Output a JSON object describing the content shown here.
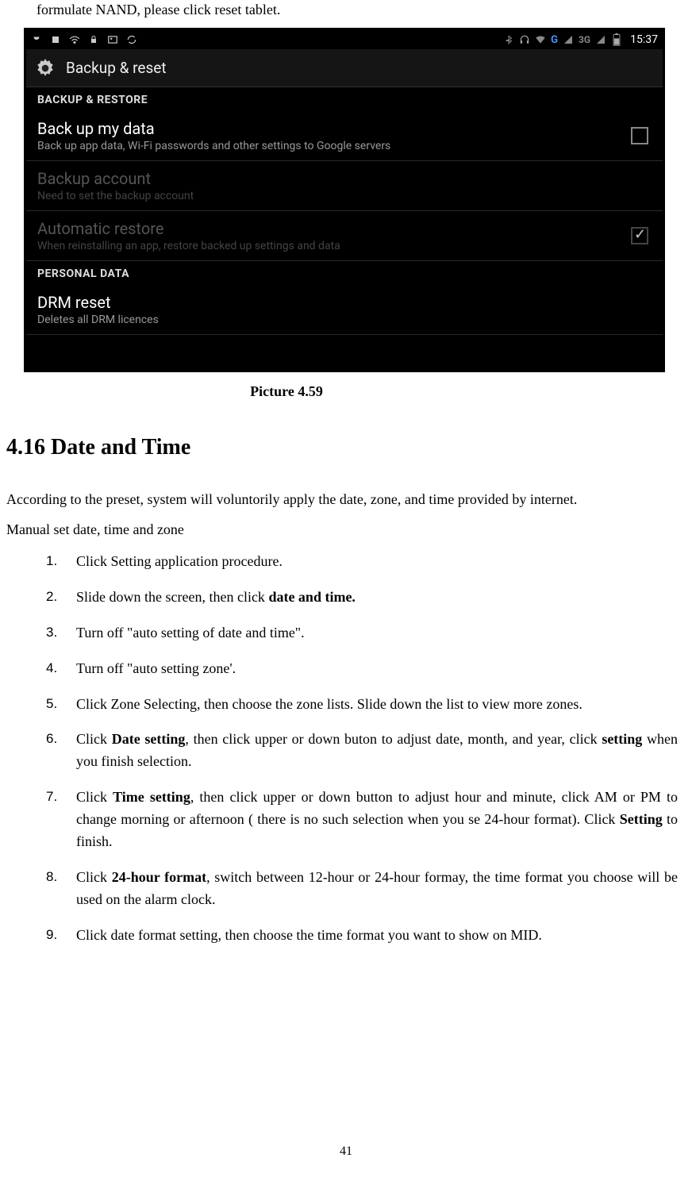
{
  "doc": {
    "top_line": "formulate NAND, please click reset tablet.",
    "caption": "Picture 4.59",
    "heading": "4.16 Date and Time",
    "para1": "According to the preset, system will voluntorily apply the date, zone, and time provided by internet.",
    "para2": "Manual set date, time and zone",
    "steps": {
      "s1": "Click Setting application procedure.",
      "s2a": "Slide down the screen, then click ",
      "s2b": "date and time.",
      "s3": "Turn off \"auto setting of date and time\".",
      "s4": "Turn off \"auto setting zone'.",
      "s5": "Click Zone Selecting, then choose the zone lists. Slide down the list to view more zones.",
      "s6a": "Click ",
      "s6b": "Date setting",
      "s6c": ", then click upper or down buton to adjust date, month, and year, click ",
      "s6d": "setting",
      "s6e": " when you finish selection.",
      "s7a": "Click ",
      "s7b": "Time setting",
      "s7c": ", then click upper or down button to adjust hour and minute, click AM or PM to change morning or afternoon ( there is no such selection when you se 24-hour format). Click ",
      "s7d": "Setting",
      "s7e": " to finish.",
      "s8a": "Click ",
      "s8b": "24-hour format",
      "s8c": ", switch between 12-hour or 24-hour formay, the time format you choose will be used on the alarm clock.",
      "s9": "Click date format setting, then choose the time format you want to show on MID."
    },
    "page_number": "41"
  },
  "shot": {
    "clock": "15:37",
    "sig3g": "3G",
    "sigG": "G",
    "app_title": "Backup & reset",
    "section1": "BACKUP & RESTORE",
    "r1_title": "Back up my data",
    "r1_sub": "Back up app data, Wi-Fi passwords and other settings to Google servers",
    "r2_title": "Backup account",
    "r2_sub": "Need to set the backup account",
    "r3_title": "Automatic restore",
    "r3_sub": "When reinstalling an app, restore backed up settings and data",
    "section2": "PERSONAL DATA",
    "r4_title": "DRM reset",
    "r4_sub": "Deletes all DRM licences"
  }
}
